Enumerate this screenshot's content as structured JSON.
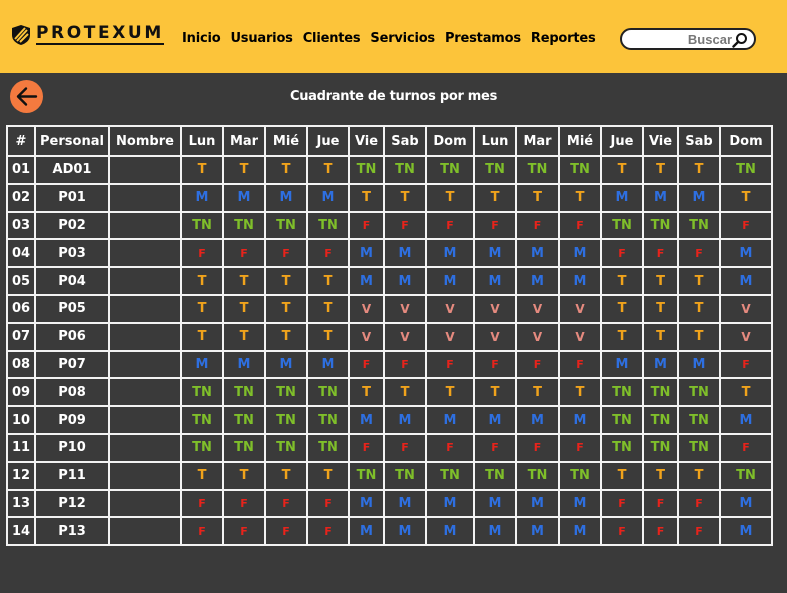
{
  "header": {
    "brand": "PROTEXUM",
    "nav": [
      "Inicio",
      "Usuarios",
      "Clientes",
      "Servicios",
      "Prestamos",
      "Reportes"
    ],
    "search_placeholder": "Buscar"
  },
  "page": {
    "title": "Cuadrante de turnos por mes"
  },
  "table": {
    "headers": [
      "#",
      "Personal",
      "Nombre",
      "Lun",
      "Mar",
      "Mié",
      "Jue",
      "Vie",
      "Sab",
      "Dom",
      "Lun",
      "Mar",
      "Mié",
      "Jue",
      "Vie",
      "Sab",
      "Dom"
    ],
    "rows": [
      {
        "num": "01",
        "personal": "AD01",
        "nombre": "",
        "shifts": [
          "T",
          "T",
          "T",
          "T",
          "TN",
          "TN",
          "TN",
          "TN",
          "TN",
          "TN",
          "T",
          "T",
          "T",
          "TN"
        ]
      },
      {
        "num": "02",
        "personal": "P01",
        "nombre": "",
        "shifts": [
          "M",
          "M",
          "M",
          "M",
          "T",
          "T",
          "T",
          "T",
          "T",
          "T",
          "M",
          "M",
          "M",
          "T"
        ]
      },
      {
        "num": "03",
        "personal": "P02",
        "nombre": "",
        "shifts": [
          "TN",
          "TN",
          "TN",
          "TN",
          "F",
          "F",
          "F",
          "F",
          "F",
          "F",
          "TN",
          "TN",
          "TN",
          "F"
        ]
      },
      {
        "num": "04",
        "personal": "P03",
        "nombre": "",
        "shifts": [
          "F",
          "F",
          "F",
          "F",
          "M",
          "M",
          "M",
          "M",
          "M",
          "M",
          "F",
          "F",
          "F",
          "M"
        ]
      },
      {
        "num": "05",
        "personal": "P04",
        "nombre": "",
        "shifts": [
          "T",
          "T",
          "T",
          "T",
          "M",
          "M",
          "M",
          "M",
          "M",
          "M",
          "T",
          "T",
          "T",
          "M"
        ]
      },
      {
        "num": "06",
        "personal": "P05",
        "nombre": "",
        "shifts": [
          "T",
          "T",
          "T",
          "T",
          "V",
          "V",
          "V",
          "V",
          "V",
          "V",
          "T",
          "T",
          "T",
          "V"
        ]
      },
      {
        "num": "07",
        "personal": "P06",
        "nombre": "",
        "shifts": [
          "T",
          "T",
          "T",
          "T",
          "V",
          "V",
          "V",
          "V",
          "V",
          "V",
          "T",
          "T",
          "T",
          "V"
        ]
      },
      {
        "num": "08",
        "personal": "P07",
        "nombre": "",
        "shifts": [
          "M",
          "M",
          "M",
          "M",
          "F",
          "F",
          "F",
          "F",
          "F",
          "F",
          "M",
          "M",
          "M",
          "F"
        ]
      },
      {
        "num": "09",
        "personal": "P08",
        "nombre": "",
        "shifts": [
          "TN",
          "TN",
          "TN",
          "TN",
          "T",
          "T",
          "T",
          "T",
          "T",
          "T",
          "TN",
          "TN",
          "TN",
          "T"
        ]
      },
      {
        "num": "10",
        "personal": "P09",
        "nombre": "",
        "shifts": [
          "TN",
          "TN",
          "TN",
          "TN",
          "M",
          "M",
          "M",
          "M",
          "M",
          "M",
          "TN",
          "TN",
          "TN",
          "M"
        ]
      },
      {
        "num": "11",
        "personal": "P10",
        "nombre": "",
        "shifts": [
          "TN",
          "TN",
          "TN",
          "TN",
          "F",
          "F",
          "F",
          "F",
          "F",
          "F",
          "TN",
          "TN",
          "TN",
          "F"
        ]
      },
      {
        "num": "12",
        "personal": "P11",
        "nombre": "",
        "shifts": [
          "T",
          "T",
          "T",
          "T",
          "TN",
          "TN",
          "TN",
          "TN",
          "TN",
          "TN",
          "T",
          "T",
          "T",
          "TN"
        ]
      },
      {
        "num": "13",
        "personal": "P12",
        "nombre": "",
        "shifts": [
          "F",
          "F",
          "F",
          "F",
          "M",
          "M",
          "M",
          "M",
          "M",
          "M",
          "F",
          "F",
          "F",
          "M"
        ]
      },
      {
        "num": "14",
        "personal": "P13",
        "nombre": "",
        "shifts": [
          "F",
          "F",
          "F",
          "F",
          "M",
          "M",
          "M",
          "M",
          "M",
          "M",
          "F",
          "F",
          "F",
          "M"
        ]
      }
    ]
  },
  "colors": {
    "header_bg": "#fcc43a",
    "body_bg": "#3a3a3a",
    "back_button": "#f47a3f",
    "T": "#f0a31c",
    "TN": "#7fbf2a",
    "M": "#2e6fe0",
    "F": "#e8231b",
    "V": "#e58a7f"
  },
  "icons": {
    "logo": "shield-stripes-icon",
    "search": "search-icon",
    "back": "arrow-left-icon"
  }
}
